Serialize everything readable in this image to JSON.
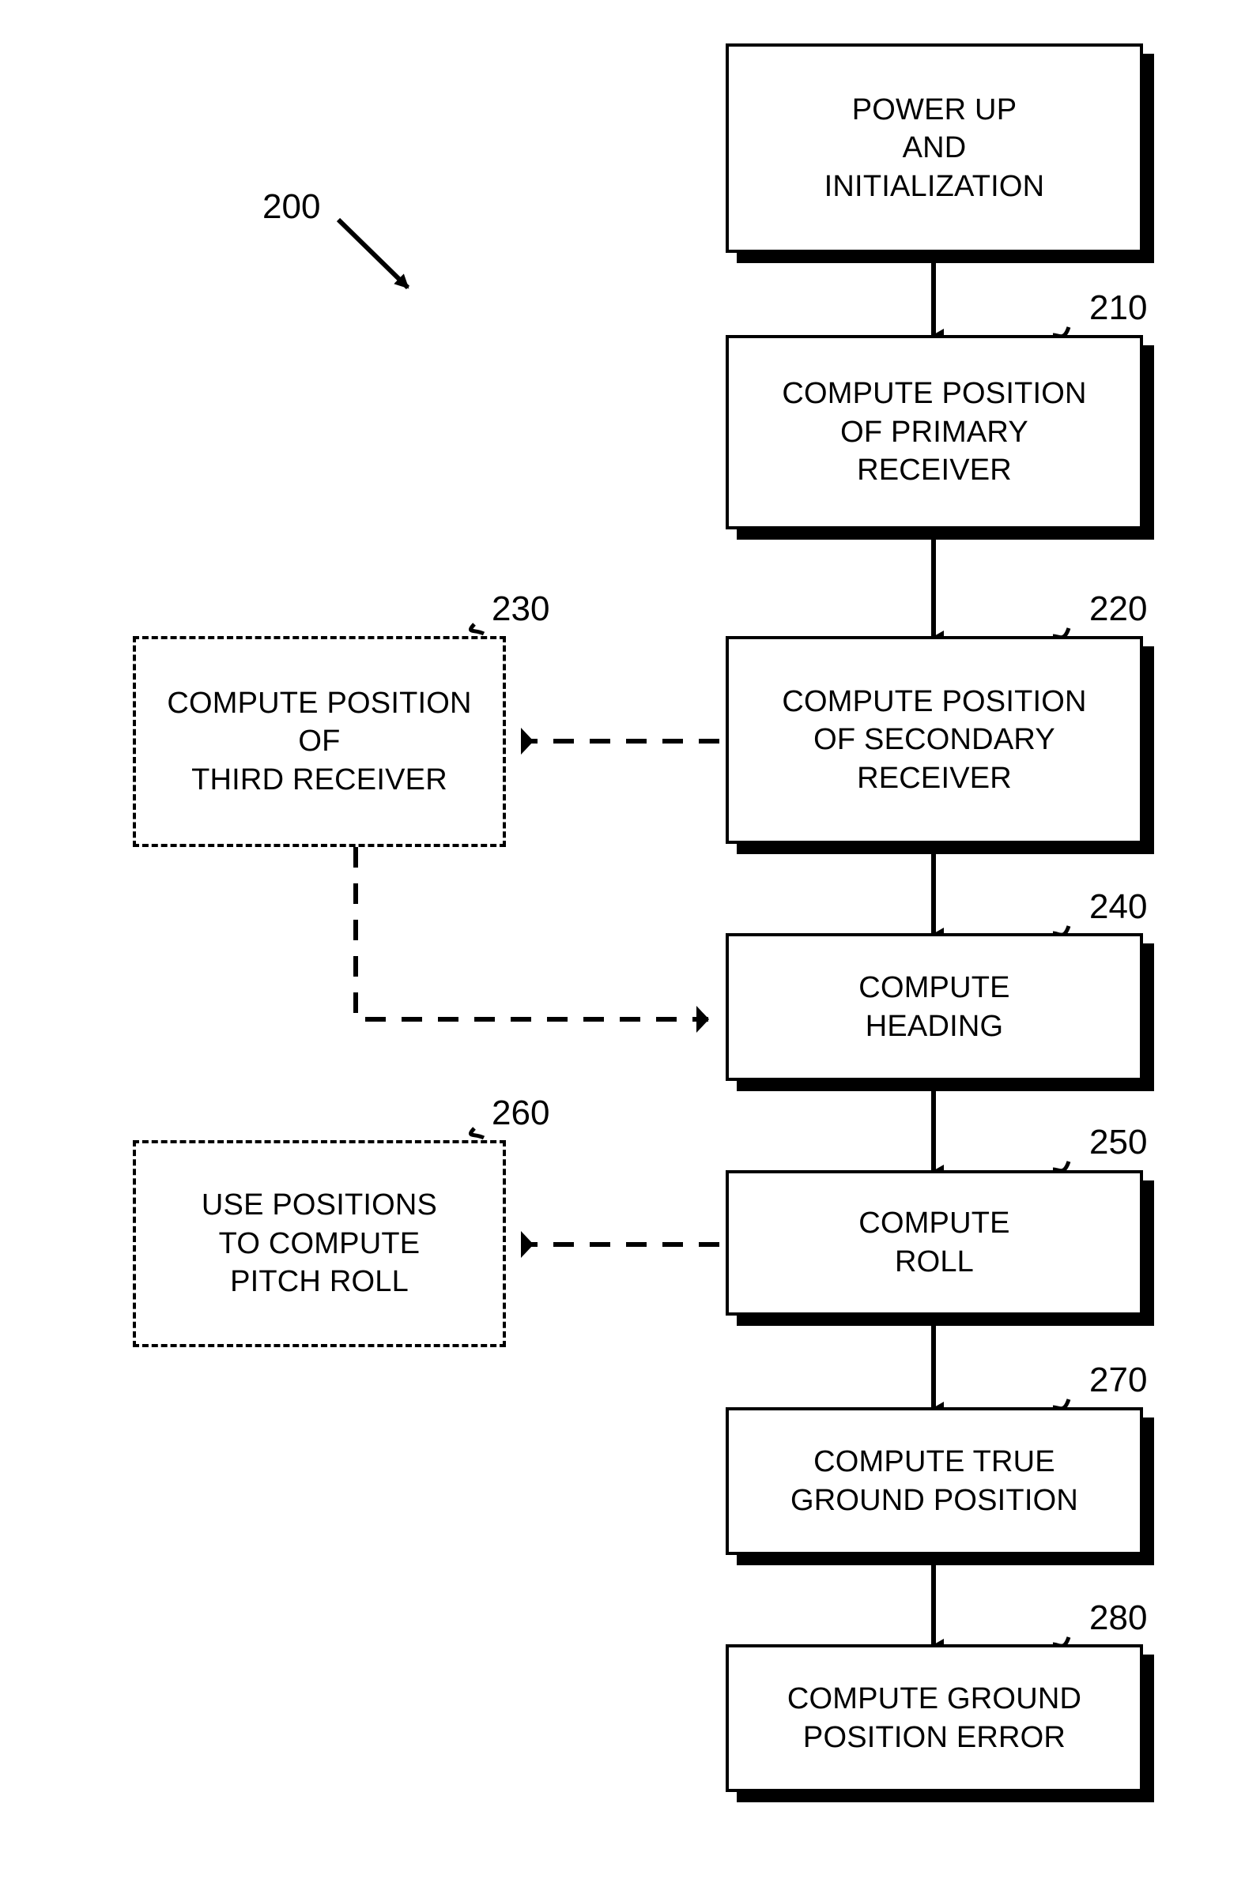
{
  "figure": {
    "figure_ref": "200",
    "background_color": "#ffffff",
    "line_color": "#000000"
  },
  "nodes": [
    {
      "id": "power-up",
      "ref": "",
      "text": "POWER UP\nAND\nINITIALIZATION",
      "style": "solid"
    },
    {
      "id": "compute-position-primary-receiver",
      "ref": "210",
      "text": "COMPUTE POSITION\nOF PRIMARY\nRECEIVER",
      "style": "solid"
    },
    {
      "id": "compute-position-secondary-receiver",
      "ref": "220",
      "text": "COMPUTE POSITION\nOF SECONDARY\nRECEIVER",
      "style": "solid"
    },
    {
      "id": "compute-position-third-receiver",
      "ref": "230",
      "text": "COMPUTE POSITION\nOF\nTHIRD RECEIVER",
      "style": "dashed"
    },
    {
      "id": "compute-heading",
      "ref": "240",
      "text": "COMPUTE\nHEADING",
      "style": "solid"
    },
    {
      "id": "compute-roll",
      "ref": "250",
      "text": "COMPUTE\nROLL",
      "style": "solid"
    },
    {
      "id": "use-positions-to-compute-pitch-roll",
      "ref": "260",
      "text": "USE POSITIONS\nTO COMPUTE\nPITCH ROLL",
      "style": "dashed"
    },
    {
      "id": "compute-true-ground-position",
      "ref": "270",
      "text": "COMPUTE TRUE\nGROUND POSITION",
      "style": "solid"
    },
    {
      "id": "compute-ground-position-error",
      "ref": "280",
      "text": "COMPUTE GROUND\nPOSITION ERROR",
      "style": "solid"
    }
  ],
  "connectors": [
    {
      "id": "power-up-to-210",
      "kind": "solid-arrow-down"
    },
    {
      "id": "210-to-220",
      "kind": "solid-arrow-down"
    },
    {
      "id": "220-to-230",
      "kind": "dashed-arrow-left"
    },
    {
      "id": "220-to-240",
      "kind": "solid-arrow-down"
    },
    {
      "id": "230-to-240",
      "kind": "dashed-arrow-elbow-right"
    },
    {
      "id": "240-to-250",
      "kind": "solid-arrow-down"
    },
    {
      "id": "250-to-260",
      "kind": "dashed-arrow-left"
    },
    {
      "id": "250-to-270",
      "kind": "solid-arrow-down"
    },
    {
      "id": "270-to-280",
      "kind": "solid-arrow-down"
    }
  ]
}
